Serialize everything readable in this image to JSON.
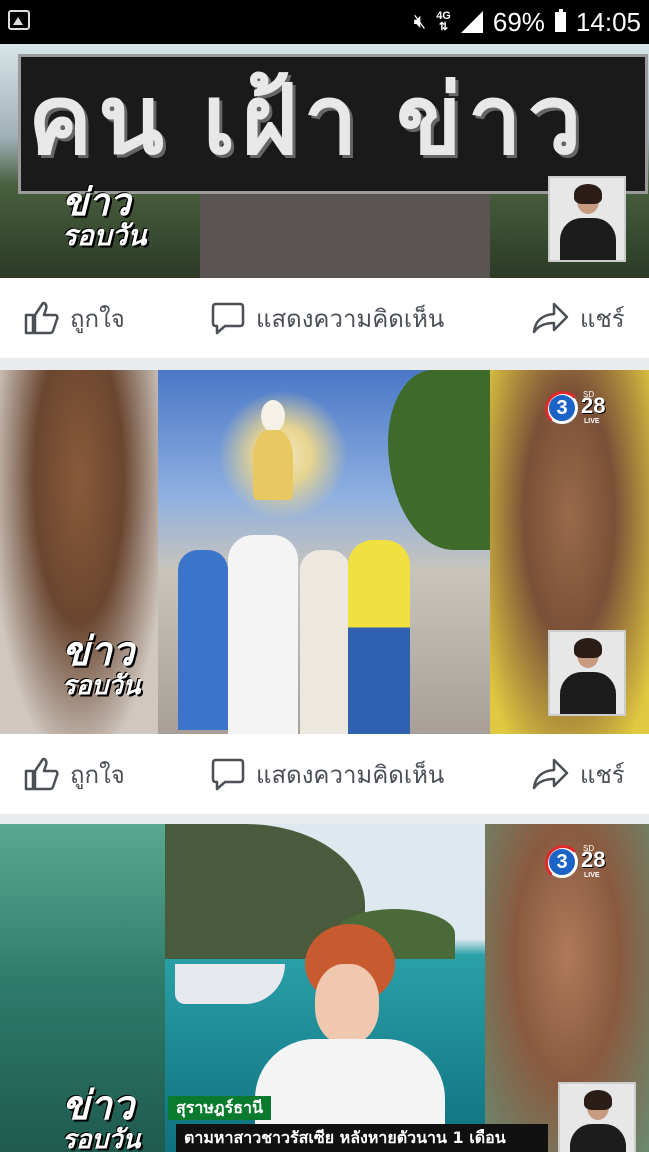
{
  "status_bar": {
    "icons": [
      "gallery-icon",
      "mute-icon",
      "signal-icon",
      "battery-icon"
    ],
    "network": "4G",
    "battery": "69%",
    "time": "14:05"
  },
  "posts": [
    {
      "banner_text": "คน เฝ้า ข่าว",
      "program": [
        "ข่าว",
        "รอบวัน"
      ],
      "actions": {
        "like": "ถูกใจ",
        "comment": "แสดงความคิดเห็น",
        "share": "แชร์"
      }
    },
    {
      "channel": {
        "number": "3",
        "hd": "28",
        "sd_label": "SD",
        "live_label": "LIVE"
      },
      "program": [
        "ข่าว",
        "รอบวัน"
      ],
      "actions": {
        "like": "ถูกใจ",
        "comment": "แสดงความคิดเห็น",
        "share": "แชร์"
      }
    },
    {
      "channel": {
        "number": "3",
        "hd": "28",
        "sd_label": "SD",
        "live_label": "LIVE"
      },
      "program": [
        "ข่าว",
        "รอบวัน"
      ],
      "location": "สุราษฎร์ธานี",
      "headline": "ตามหาสาวชาวรัสเซีย หลังหายตัวนาน 1 เดือน"
    }
  ],
  "colors": {
    "action_text": "#4b4f56",
    "feed_bg": "#e9ebee",
    "channel_blue": "#1b63c4",
    "ticker_green": "#0a7a2e"
  }
}
